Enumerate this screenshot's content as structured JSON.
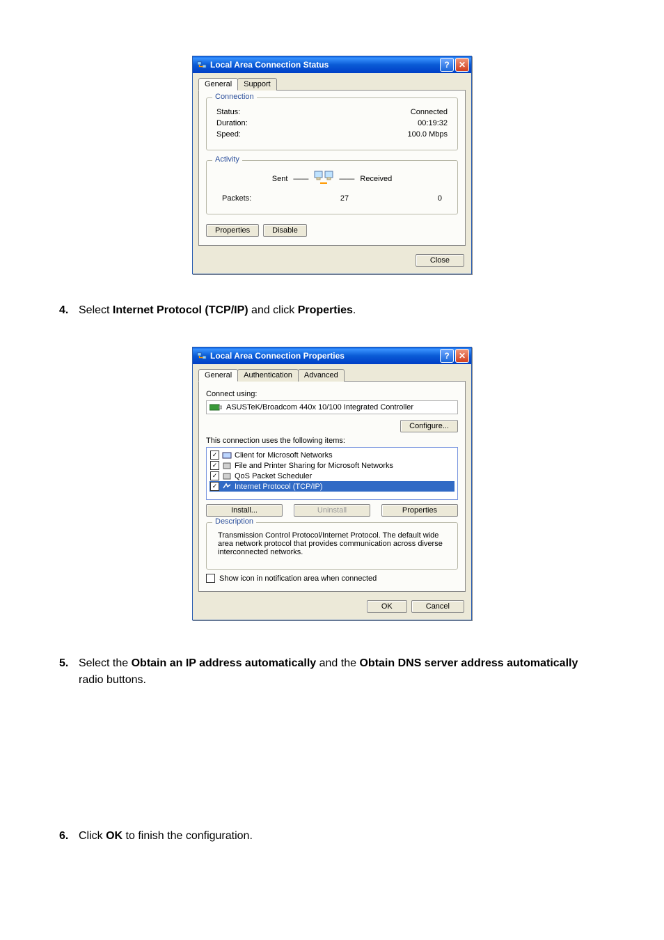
{
  "dialog1": {
    "title": "Local Area Connection Status",
    "tabs": {
      "general": "General",
      "support": "Support"
    },
    "connection": {
      "legend": "Connection",
      "status_label": "Status:",
      "status_value": "Connected",
      "duration_label": "Duration:",
      "duration_value": "00:19:32",
      "speed_label": "Speed:",
      "speed_value": "100.0 Mbps"
    },
    "activity": {
      "legend": "Activity",
      "sent": "Sent",
      "received": "Received",
      "packets_label": "Packets:",
      "packets_sent": "27",
      "packets_recv": "0"
    },
    "buttons": {
      "properties": "Properties",
      "disable": "Disable",
      "close": "Close"
    }
  },
  "step4": {
    "num": "4.",
    "pre": "Select ",
    "bold1": "Internet Protocol (TCP/IP)",
    "mid": " and click ",
    "bold2": "Properties",
    "post": "."
  },
  "dialog2": {
    "title": "Local Area Connection Properties",
    "tabs": {
      "general": "General",
      "auth": "Authentication",
      "advanced": "Advanced"
    },
    "connect_using_label": "Connect using:",
    "adapter": "ASUSTeK/Broadcom 440x 10/100 Integrated Controller",
    "configure": "Configure...",
    "uses_label": "This connection uses the following items:",
    "items": [
      "Client for Microsoft Networks",
      "File and Printer Sharing for Microsoft Networks",
      "QoS Packet Scheduler",
      "Internet Protocol (TCP/IP)"
    ],
    "install": "Install...",
    "uninstall": "Uninstall",
    "properties": "Properties",
    "desc_legend": "Description",
    "desc_text": "Transmission Control Protocol/Internet Protocol. The default wide area network protocol that provides communication across diverse interconnected networks.",
    "notif": "Show icon in notification area when connected",
    "ok": "OK",
    "cancel": "Cancel"
  },
  "step5": {
    "num": "5.",
    "pre": "Select the ",
    "bold1": "Obtain an IP address automatically",
    "mid": " and the ",
    "bold2": "Obtain DNS server address automatically",
    "post": " radio buttons."
  },
  "step6": {
    "num": "6.",
    "pre": "Click ",
    "bold1": "OK",
    "post": " to finish the configuration."
  }
}
